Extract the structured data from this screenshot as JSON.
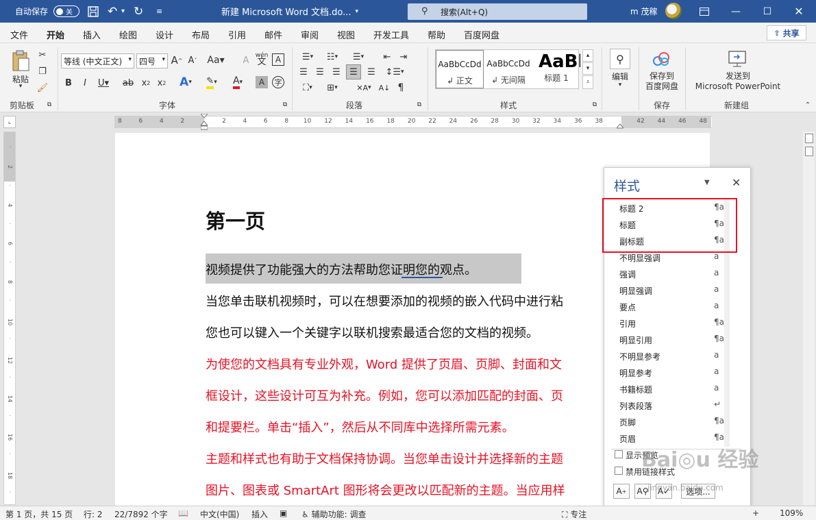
{
  "titlebar": {
    "autosave_label": "自动保存",
    "autosave_state": "关",
    "doc_title": "新建 Microsoft Word 文档.do...",
    "search_placeholder": "搜索(Alt+Q)",
    "user_name": "m 茂稼"
  },
  "menu": {
    "tabs": [
      "文件",
      "开始",
      "插入",
      "绘图",
      "设计",
      "布局",
      "引用",
      "邮件",
      "审阅",
      "视图",
      "开发工具",
      "帮助",
      "百度网盘"
    ],
    "active_tab": "开始",
    "share": "共享"
  },
  "ribbon": {
    "clipboard": {
      "paste": "粘贴",
      "label": "剪贴板"
    },
    "font": {
      "name": "等线 (中文正文)",
      "size": "四号",
      "label": "字体"
    },
    "paragraph": {
      "label": "段落"
    },
    "styles": {
      "label": "样式",
      "items": [
        {
          "preview": "AaBbCcDd",
          "name": "↲ 正文"
        },
        {
          "preview": "AaBbCcDd",
          "name": "↲ 无间隔"
        },
        {
          "preview": "AaBl",
          "name": "标题 1"
        }
      ]
    },
    "editing": {
      "label": "编辑"
    },
    "save": {
      "button": "保存到\n百度网盘",
      "label": "保存"
    },
    "newgroup": {
      "button": "发送到\nMicrosoft PowerPoint",
      "label": "新建组"
    }
  },
  "ruler": {
    "ticks": [
      "8",
      "6",
      "4",
      "2",
      "",
      "2",
      "4",
      "6",
      "8",
      "10",
      "12",
      "14",
      "16",
      "18",
      "20",
      "22",
      "24",
      "26",
      "28",
      "30",
      "32",
      "34",
      "36",
      "38",
      "",
      "42",
      "44",
      "46",
      "48"
    ]
  },
  "document": {
    "heading": "第一页",
    "paragraphs": [
      {
        "text": "视频提供了功能强大的方法帮助您证明您的观点。",
        "color": "#111111"
      },
      {
        "text": "当您单击联机视频时，可以在想要添加的视频的嵌入代码中进行粘",
        "color": "#111111"
      },
      {
        "text": "您也可以键入一个关键字以联机搜索最适合您的文档的视频。",
        "color": "#111111"
      },
      {
        "text": "为使您的文档具有专业外观，Word 提供了页眉、页脚、封面和文",
        "color": "#e81123"
      },
      {
        "text": "框设计，这些设计可互为补充。例如，您可以添加匹配的封面、页",
        "color": "#e81123"
      },
      {
        "text": "和提要栏。单击“插入”，然后从不同库中选择所需元素。",
        "color": "#e81123"
      },
      {
        "text": "主题和样式也有助于文档保持协调。当您单击设计并选择新的主题",
        "color": "#e81123"
      },
      {
        "text": "图片、图表或 SmartArt 图形将会更改以匹配新的主题。当应用样",
        "color": "#e81123"
      }
    ]
  },
  "styles_pane": {
    "title": "样式",
    "items": [
      {
        "name": "标题 2",
        "symbol": "¶a"
      },
      {
        "name": "标题",
        "symbol": "¶a"
      },
      {
        "name": "副标题",
        "symbol": "¶a"
      },
      {
        "name": "不明显强调",
        "symbol": "a"
      },
      {
        "name": "强调",
        "symbol": "a"
      },
      {
        "name": "明显强调",
        "symbol": "a"
      },
      {
        "name": "要点",
        "symbol": "a"
      },
      {
        "name": "引用",
        "symbol": "¶a"
      },
      {
        "name": "明显引用",
        "symbol": "¶a"
      },
      {
        "name": "不明显参考",
        "symbol": "a"
      },
      {
        "name": "明显参考",
        "symbol": "a"
      },
      {
        "name": "书籍标题",
        "symbol": "a"
      },
      {
        "name": "列表段落",
        "symbol": "↵"
      },
      {
        "name": "页脚",
        "symbol": "¶a"
      },
      {
        "name": "页眉",
        "symbol": "¶a"
      }
    ],
    "show_preview": "显示预览",
    "disable_linked": "禁用链接样式",
    "options_button": "选项..."
  },
  "statusbar": {
    "page": "第 1 页，共 15 页",
    "row": "行: 2",
    "words": "22/7892 个字",
    "language": "中文(中国)",
    "insert": "插入",
    "accessibility": "辅助功能: 调查",
    "focus": "专注",
    "zoom": "109%"
  },
  "colors": {
    "accent": "#2b579a",
    "red": "#e81123"
  }
}
